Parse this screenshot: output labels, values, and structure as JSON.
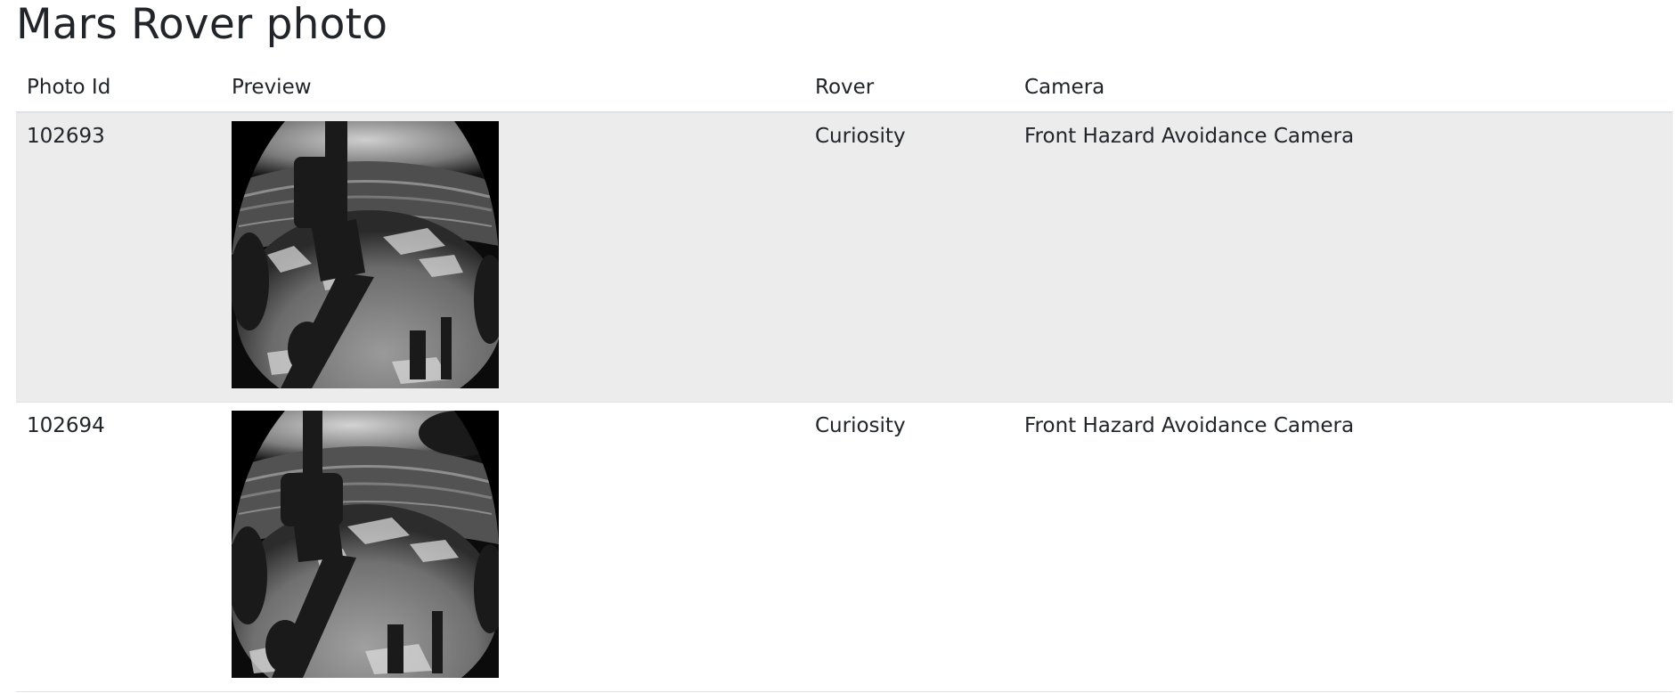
{
  "page": {
    "title": "Mars Rover photo"
  },
  "table": {
    "headers": {
      "photo_id": "Photo Id",
      "preview": "Preview",
      "rover": "Rover",
      "camera": "Camera"
    },
    "rows": [
      {
        "photo_id": "102693",
        "preview_icon": "mars-surface-photo",
        "rover": "Curiosity",
        "camera": "Front Hazard Avoidance Camera"
      },
      {
        "photo_id": "102694",
        "preview_icon": "mars-surface-photo",
        "rover": "Curiosity",
        "camera": "Front Hazard Avoidance Camera"
      }
    ]
  },
  "colors": {
    "text": "#212529",
    "stripe": "#ececec",
    "border": "#dee2e6"
  }
}
